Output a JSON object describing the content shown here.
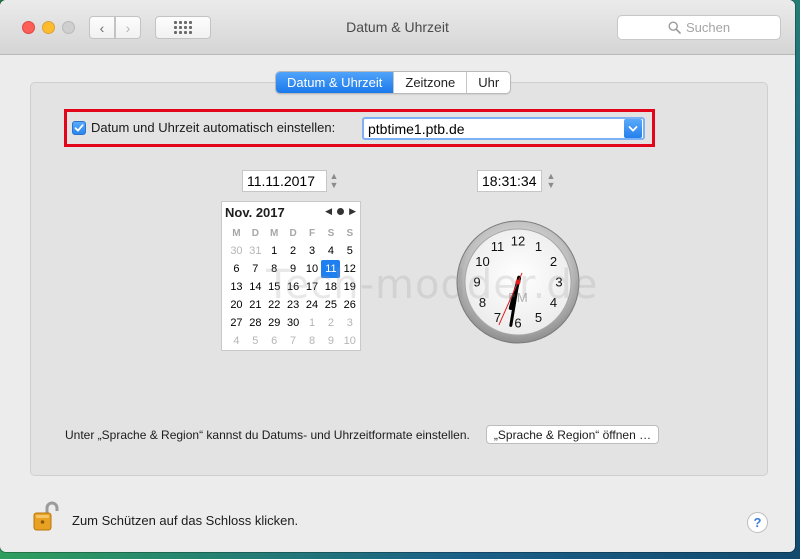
{
  "window": {
    "title": "Datum & Uhrzeit"
  },
  "search": {
    "placeholder": "Suchen"
  },
  "tabs": [
    {
      "label": "Datum & Uhrzeit",
      "active": true
    },
    {
      "label": "Zeitzone",
      "active": false
    },
    {
      "label": "Uhr",
      "active": false
    }
  ],
  "auto": {
    "label": "Datum und Uhrzeit automatisch einstellen:",
    "checked": true,
    "server": "ptbtime1.ptb.de"
  },
  "date": "11.11.2017",
  "time": "18:31:34",
  "calendar": {
    "month": "Nov. 2017",
    "weekdays": [
      "M",
      "D",
      "M",
      "D",
      "F",
      "S",
      "S"
    ],
    "weeks": [
      [
        "30",
        "31",
        "1",
        "2",
        "3",
        "4",
        "5"
      ],
      [
        "6",
        "7",
        "8",
        "9",
        "10",
        "11",
        "12"
      ],
      [
        "13",
        "14",
        "15",
        "16",
        "17",
        "18",
        "19"
      ],
      [
        "20",
        "21",
        "22",
        "23",
        "24",
        "25",
        "26"
      ],
      [
        "27",
        "28",
        "29",
        "30",
        "1",
        "2",
        "3"
      ],
      [
        "4",
        "5",
        "6",
        "7",
        "8",
        "9",
        "10"
      ]
    ],
    "selected": "11"
  },
  "clock": {
    "numbers": [
      "12",
      "1",
      "2",
      "3",
      "4",
      "5",
      "6",
      "7",
      "8",
      "9",
      "10",
      "11"
    ],
    "meridiem": "PM",
    "hours": 18,
    "minutes": 31,
    "seconds": 34
  },
  "region": {
    "text": "Unter „Sprache & Region“ kannst du Datums- und Uhrzeitformate einstellen.",
    "button": "„Sprache & Region“ öffnen …"
  },
  "lock": {
    "text": "Zum Schützen auf das Schloss klicken."
  },
  "help": {
    "label": "?"
  },
  "watermark": "Tech-modder.de",
  "colors": {
    "accent": "#1d7ff0",
    "highlight": "#e3061a"
  }
}
